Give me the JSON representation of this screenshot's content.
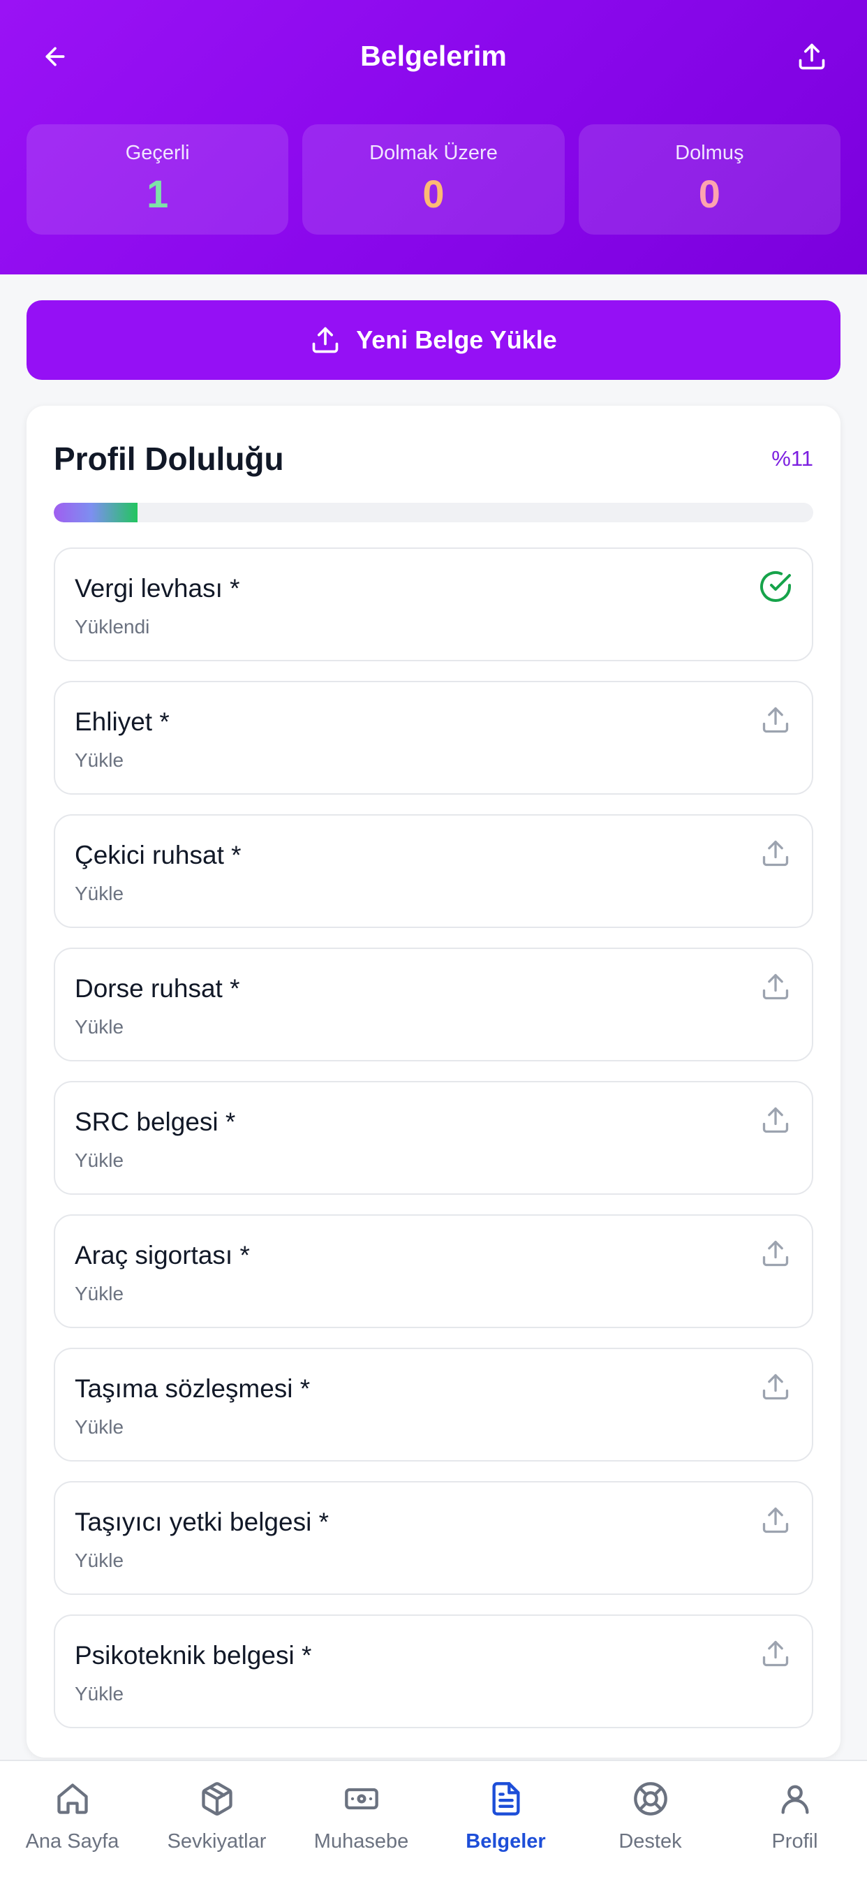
{
  "header": {
    "title": "Belgelerim",
    "back_icon": "arrow-left-icon",
    "share_icon": "upload-icon"
  },
  "stats": [
    {
      "label": "Geçerli",
      "value": "1",
      "color": "#7ee2a8"
    },
    {
      "label": "Dolmak Üzere",
      "value": "0",
      "color": "#fdba74"
    },
    {
      "label": "Dolmuş",
      "value": "0",
      "color": "#fda4af"
    }
  ],
  "upload_button": {
    "label": "Yeni Belge Yükle"
  },
  "profile": {
    "title": "Profil Doluluğu",
    "percent_label": "%11",
    "percent": 11
  },
  "documents": [
    {
      "name": "Vergi levhası *",
      "status": "Yüklendi",
      "uploaded": true
    },
    {
      "name": "Ehliyet *",
      "status": "Yükle",
      "uploaded": false
    },
    {
      "name": "Çekici ruhsat *",
      "status": "Yükle",
      "uploaded": false
    },
    {
      "name": "Dorse ruhsat *",
      "status": "Yükle",
      "uploaded": false
    },
    {
      "name": "SRC belgesi *",
      "status": "Yükle",
      "uploaded": false
    },
    {
      "name": "Araç sigortası *",
      "status": "Yükle",
      "uploaded": false
    },
    {
      "name": "Taşıma sözleşmesi *",
      "status": "Yükle",
      "uploaded": false
    },
    {
      "name": "Taşıyıcı yetki belgesi *",
      "status": "Yükle",
      "uploaded": false
    },
    {
      "name": "Psikoteknik belgesi *",
      "status": "Yükle",
      "uploaded": false
    }
  ],
  "nav": [
    {
      "label": "Ana Sayfa",
      "icon": "home-icon",
      "active": false
    },
    {
      "label": "Sevkiyatlar",
      "icon": "box-icon",
      "active": false
    },
    {
      "label": "Muhasebe",
      "icon": "banknote-icon",
      "active": false
    },
    {
      "label": "Belgeler",
      "icon": "document-icon",
      "active": true
    },
    {
      "label": "Destek",
      "icon": "lifebuoy-icon",
      "active": false
    },
    {
      "label": "Profil",
      "icon": "user-icon",
      "active": false
    }
  ],
  "colors": {
    "accent": "#9510f5",
    "success": "#16a34a",
    "nav_active": "#1d4ed8"
  }
}
